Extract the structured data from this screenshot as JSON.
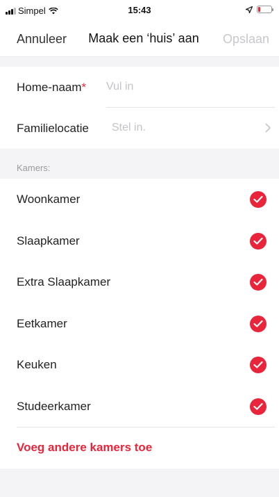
{
  "status_bar": {
    "carrier": "Simpel",
    "time": "15:43",
    "battery_level": 0.15,
    "battery_color": "#e8253a"
  },
  "nav": {
    "cancel_label": "Annuleer",
    "title": "Maak een ‘huis’ aan",
    "save_label": "Opslaan"
  },
  "form": {
    "home_name": {
      "label": "Home-naam",
      "required_mark": "*",
      "placeholder": "Vul in"
    },
    "family_location": {
      "label": "Familielocatie",
      "placeholder": "Stel in."
    }
  },
  "rooms_section_label": "Kamers:",
  "rooms": [
    {
      "name": "Woonkamer",
      "checked": true
    },
    {
      "name": "Slaapkamer",
      "checked": true
    },
    {
      "name": "Extra Slaapkamer",
      "checked": true
    },
    {
      "name": "Eetkamer",
      "checked": true
    },
    {
      "name": "Keuken",
      "checked": true
    },
    {
      "name": "Studeerkamer",
      "checked": true
    }
  ],
  "add_rooms_label": "Voeg andere kamers toe",
  "colors": {
    "accent": "#e8253a",
    "background": "#f4f4f6",
    "placeholder": "#c4c4c8"
  }
}
